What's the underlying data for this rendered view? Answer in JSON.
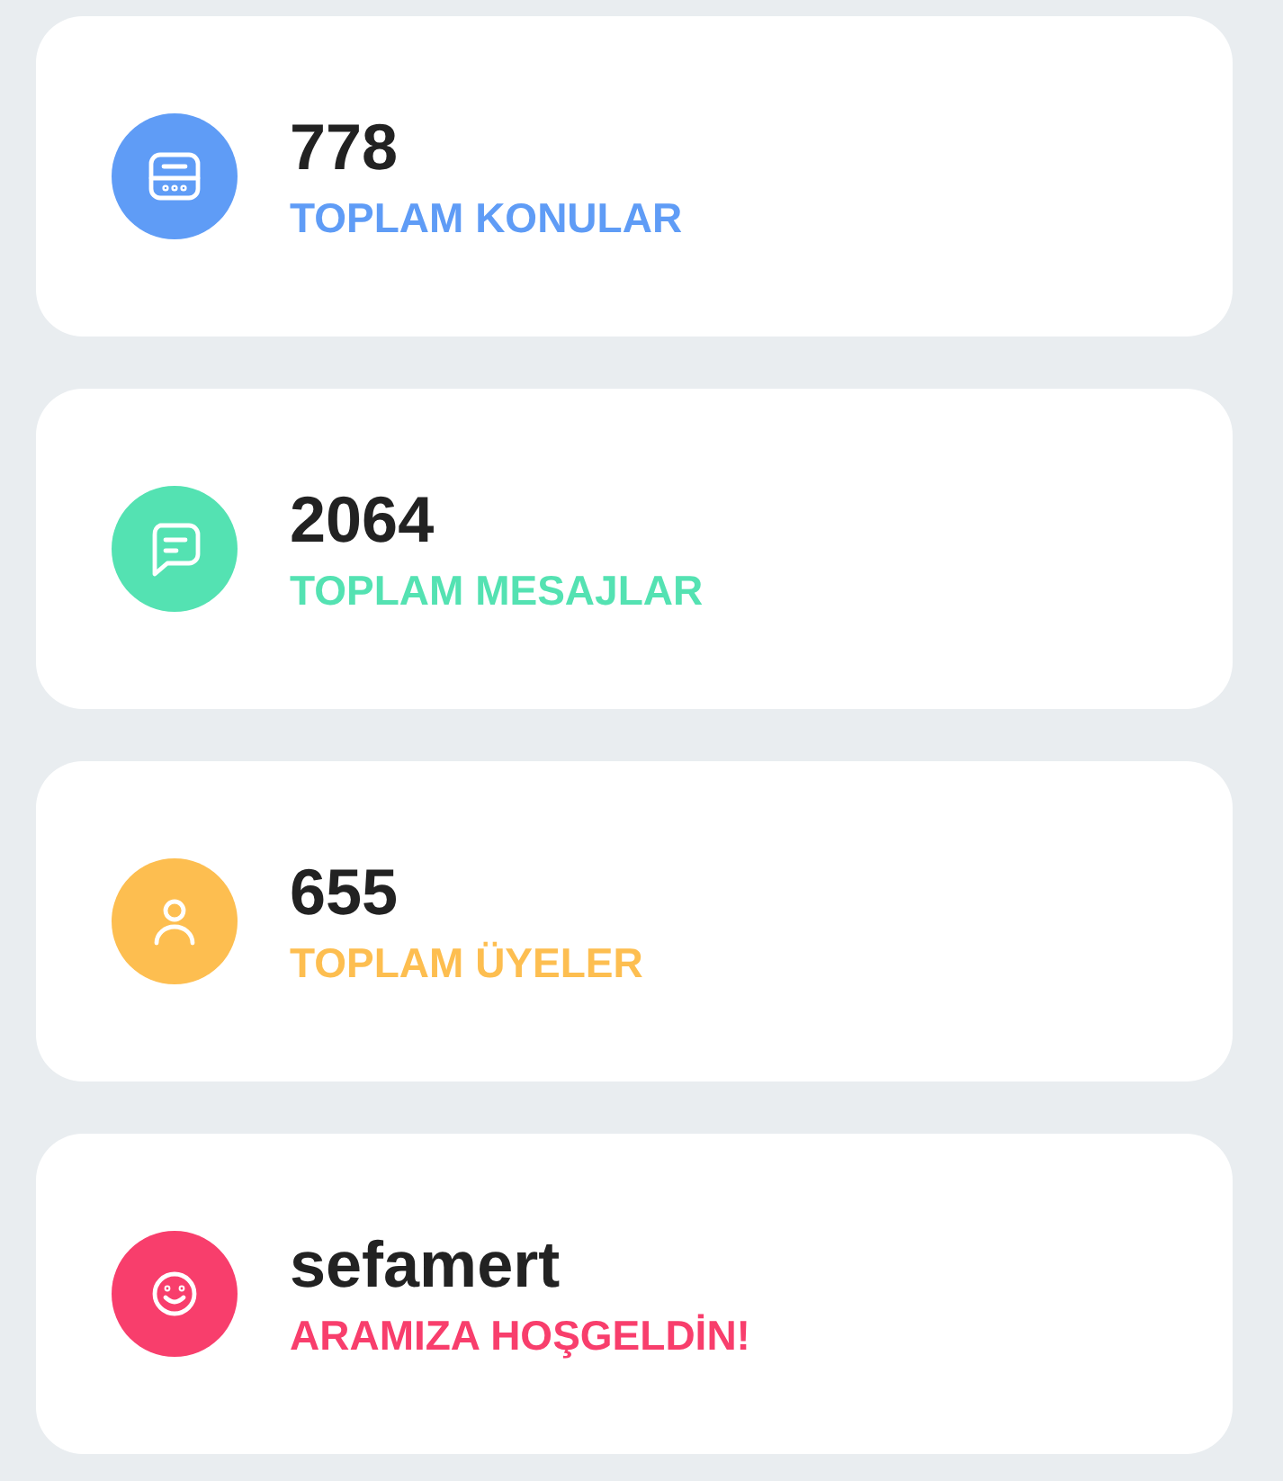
{
  "stats": [
    {
      "kind": "topics",
      "value": "778",
      "label": "TOPLAM KONULAR",
      "color": "#5f9cf6"
    },
    {
      "kind": "messages",
      "value": "2064",
      "label": "TOPLAM MESAJLAR",
      "color": "#54e2b2"
    },
    {
      "kind": "members",
      "value": "655",
      "label": "TOPLAM ÜYELER",
      "color": "#fdbe50"
    },
    {
      "kind": "welcome",
      "value": "sefamert",
      "label": "ARAMIZA HOŞGELDİN!",
      "color": "#f83e6c"
    }
  ]
}
